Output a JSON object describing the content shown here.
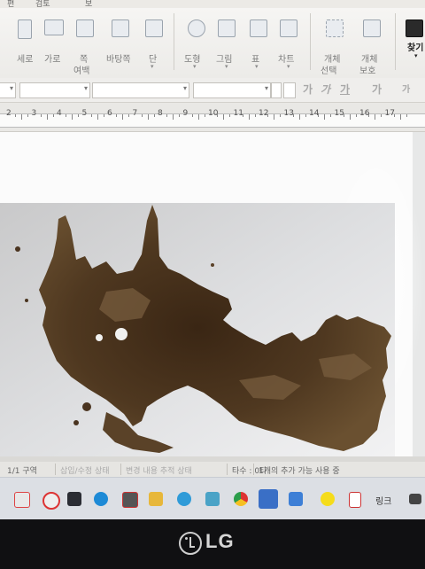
{
  "menubar": {
    "items": [
      "검토"
    ]
  },
  "ribbon": {
    "groups": [
      {
        "id": "serolo",
        "icon": "portrait-orientation-icon",
        "label": "세로"
      },
      {
        "id": "garo",
        "icon": "landscape-orientation-icon",
        "label": "가로"
      },
      {
        "id": "pok",
        "icon": "page-margin-icon",
        "label": "쪽",
        "label2": "여백"
      },
      {
        "id": "batangjjok",
        "icon": "page-background-icon",
        "label": "바탕쪽"
      },
      {
        "id": "dan",
        "icon": "columns-icon",
        "label": "단"
      },
      {
        "id": "dohyeong",
        "icon": "shapes-icon",
        "label": "도형"
      },
      {
        "id": "geurim",
        "icon": "picture-icon",
        "label": "그림"
      },
      {
        "id": "pyo",
        "icon": "table-icon",
        "label": "표"
      },
      {
        "id": "chateu",
        "icon": "chart-icon",
        "label": "차트"
      },
      {
        "id": "gaeche-seontaek",
        "icon": "object-select-icon",
        "label": "개체",
        "label2": "선택"
      },
      {
        "id": "gaeche-boho",
        "icon": "object-lock-icon",
        "label": "개체",
        "label2": "보호"
      },
      {
        "id": "chatgi",
        "icon": "find-icon",
        "label": "찾기"
      }
    ]
  },
  "format": {
    "char_buttons": [
      "가",
      "가",
      "가",
      "가",
      "가"
    ]
  },
  "ruler": {
    "numbers": [
      "2",
      "3",
      "4",
      "5",
      "6",
      "7",
      "8",
      "9",
      "10",
      "11",
      "12",
      "13",
      "14",
      "15",
      "16",
      "17"
    ]
  },
  "status": {
    "page": "1/1 구역",
    "insert": "삽입/수정 상태",
    "track": "변경 내용 추적 상태",
    "typing": "타수 : 0타",
    "spell": "1개의 추가 가능 사용 중"
  },
  "taskbar": {
    "link_label": "링크"
  },
  "monitor": {
    "brand": "LG"
  },
  "colors": {
    "ribbon_bg": "#f0efec",
    "status_bg": "#e6e5e2",
    "taskbar_bg": "#dcdfe4",
    "stain": "#4a3420"
  }
}
